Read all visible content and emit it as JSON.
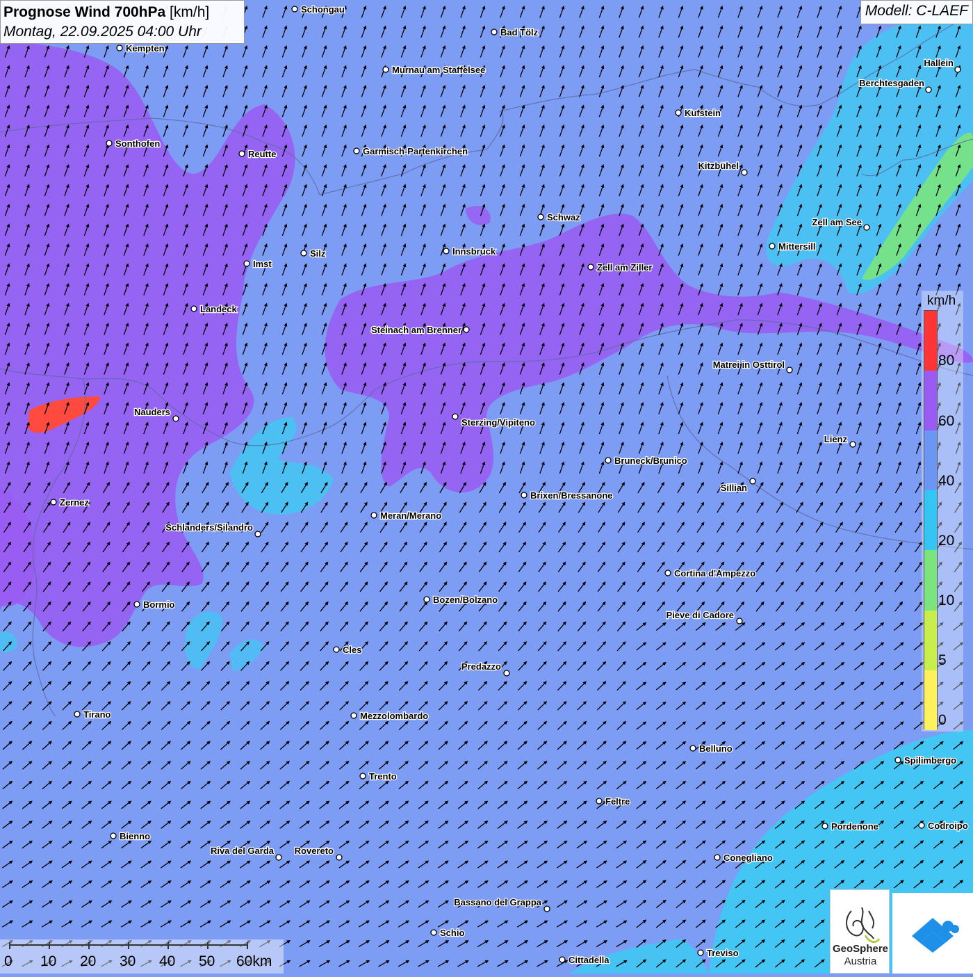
{
  "title": {
    "bold": "Prognose Wind 700hPa",
    "unit": "[km/h]",
    "date": "Montag, 22.09.2025 04:00 Uhr"
  },
  "model": "Modell: C-LAEF",
  "legend": {
    "unit": "km/h",
    "labels": [
      "80",
      "60",
      "40",
      "20",
      "10",
      "5",
      "0"
    ],
    "colors": [
      "#ff3535",
      "#9a5bf2",
      "#6b96f4",
      "#33c6f5",
      "#7ae57f",
      "#c8ee4e",
      "#fff25c"
    ]
  },
  "scalebar": {
    "labels": [
      "0",
      "10",
      "20",
      "30",
      "40",
      "50",
      "60km"
    ]
  },
  "logos": {
    "geosphere": "GeoSphere",
    "austria": "Austria"
  },
  "colors": {
    "base": "#7d9cf3",
    "strong": "#9a5bf2",
    "peak": "#ff4a40",
    "light": "#40c8f3",
    "weak": "#7ae57f"
  },
  "places": [
    "Schongau",
    "Bad Tölz",
    "Kempten",
    "Murnau am Staffelsee",
    "Hallein",
    "Berchtesgaden",
    "Kufstein",
    "Sonthofen",
    "Reutte",
    "Garmisch-Partenkirchen",
    "Kitzbühel",
    "Schwaz",
    "Zell am See",
    "Mittersill",
    "Innsbruck",
    "Silz",
    "Imst",
    "Zell am Ziller",
    "Landeck",
    "Steinach am Brenner",
    "Matrei in Osttirol",
    "Nauders",
    "Sterzing/Vipiteno",
    "Lienz",
    "Bruneck/Brunico",
    "Sillian",
    "Brixen/Bressanone",
    "Zernez",
    "Meran/Merano",
    "Schlanders/Silandro",
    "Cortina d'Ampezzo",
    "Bozen/Bolzano",
    "Bormio",
    "Pieve di Cadore",
    "Cles",
    "Predazzo",
    "Tirano",
    "Mezzolombardo",
    "Belluno",
    "Spilimbergo",
    "Trento",
    "Feltre",
    "Pordenone",
    "Codroipo",
    "Bienno",
    "Riva del Garda",
    "Rovereto",
    "Conegliano",
    "Bassano del Grappa",
    "Schio",
    "Treviso",
    "Cittadella"
  ]
}
